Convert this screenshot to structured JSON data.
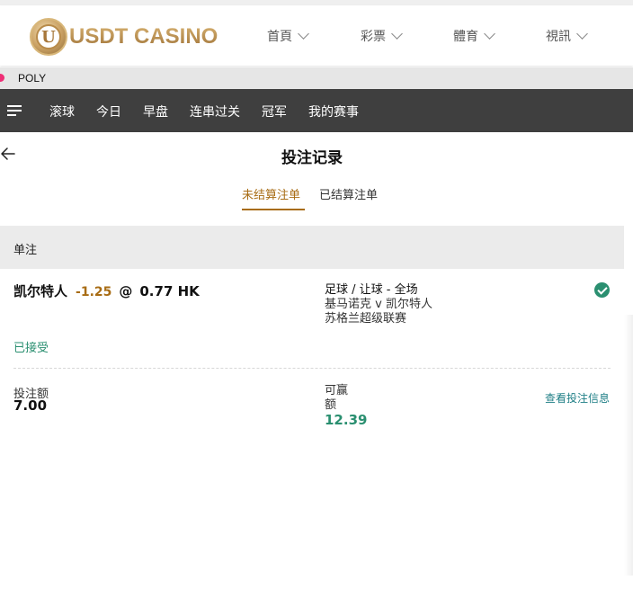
{
  "brand": {
    "logo_letter": "U",
    "name": "USDT CASINO"
  },
  "topnav": [
    {
      "label": "首頁"
    },
    {
      "label": "彩票"
    },
    {
      "label": "體育"
    },
    {
      "label": "視訊"
    }
  ],
  "provider": {
    "label": "POLY"
  },
  "sportnav": [
    {
      "label": "滚球"
    },
    {
      "label": "今日"
    },
    {
      "label": "早盘"
    },
    {
      "label": "连串过关"
    },
    {
      "label": "冠军"
    },
    {
      "label": "我的赛事"
    }
  ],
  "page": {
    "title": "投注记录"
  },
  "tabs": [
    {
      "label": "未结算注单",
      "active": true
    },
    {
      "label": "已结算注单",
      "active": false
    }
  ],
  "section": {
    "title": "单注"
  },
  "bet": {
    "selection": "凯尔特人",
    "handicap": "-1.25",
    "at": "@",
    "odds": "0.77 HK",
    "market": "足球 / 让球 - 全场",
    "match": "基马诺克 v 凯尔特人",
    "league": "苏格兰超级联赛",
    "status": "已接受",
    "stake_label": "投注额",
    "stake": "7.00",
    "win_label": "可赢额",
    "win": "12.39",
    "detail_link": "查看投注信息"
  },
  "colors": {
    "accent": "#a86c14",
    "success": "#2a8f70",
    "navbar": "#3f3f3f",
    "link": "#1f7f86"
  }
}
